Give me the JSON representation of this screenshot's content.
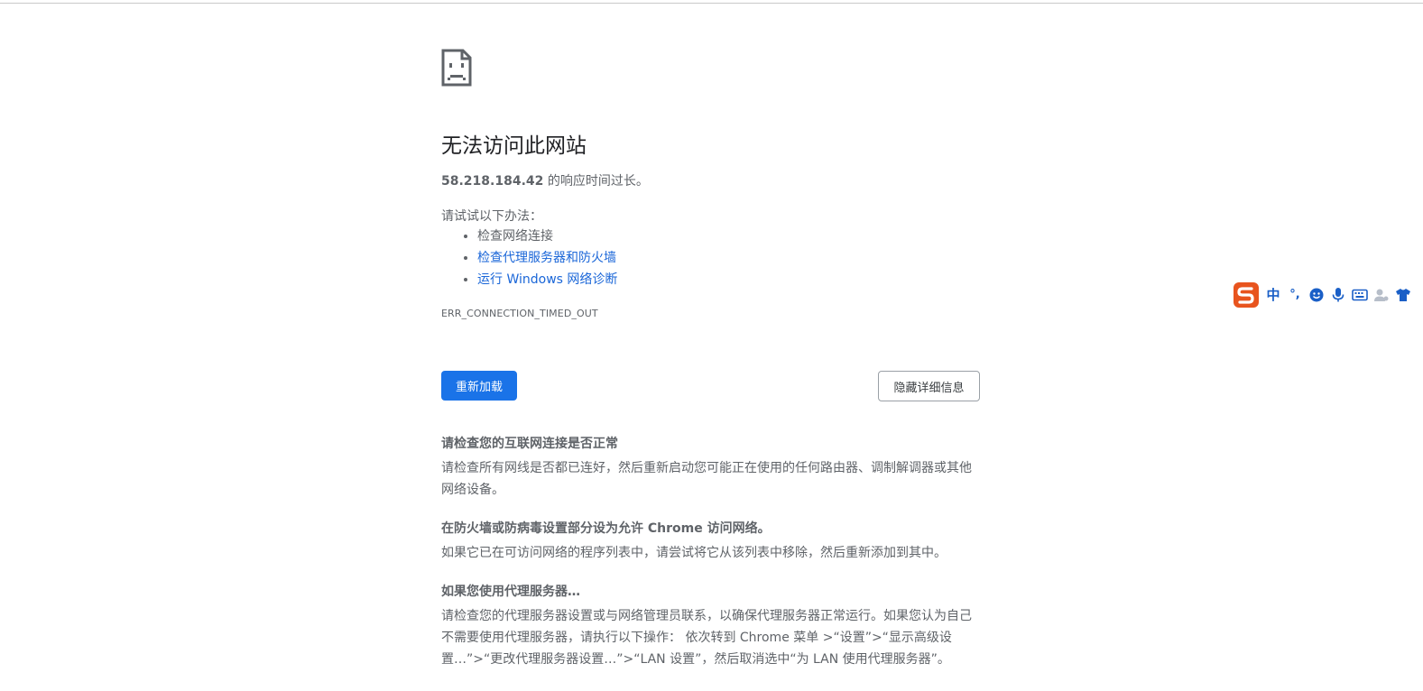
{
  "page": {
    "title": "无法访问此网站",
    "summary_host": "58.218.184.42",
    "summary_text": " 的响应时间过长。",
    "suggest_intro": "请试试以下办法：",
    "suggestions": [
      {
        "label": "检查网络连接",
        "is_link": false
      },
      {
        "label": "检查代理服务器和防火墙",
        "is_link": true
      },
      {
        "label": "运行 Windows 网络诊断",
        "is_link": true
      }
    ],
    "error_code": "ERR_CONNECTION_TIMED_OUT",
    "buttons": {
      "reload": "重新加载",
      "hide_details": "隐藏详细信息"
    }
  },
  "details": [
    {
      "heading": "请检查您的互联网连接是否正常",
      "body": "请检查所有网线是否都已连好，然后重新启动您可能正在使用的任何路由器、调制解调器或其他网络设备。"
    },
    {
      "heading": "在防火墙或防病毒设置部分设为允许 Chrome 访问网络。",
      "body": "如果它已在可访问网络的程序列表中，请尝试将它从该列表中移除，然后重新添加到其中。"
    },
    {
      "heading": "如果您使用代理服务器…",
      "body": "请检查您的代理服务器设置或与网络管理员联系，以确保代理服务器正常运行。如果您认为自己不需要使用代理服务器，请执行以下操作： 依次转到 Chrome 菜单 >“设置”>“显示高级设置…”>“更改代理服务器设置…”>“LAN 设置”，然后取消选中“为 LAN 使用代理服务器”。"
    }
  ],
  "ime": {
    "mode_label": "中",
    "punct_label": "°,",
    "icons": [
      "sogou-logo-icon",
      "emoji-icon",
      "microphone-icon",
      "keyboard-icon",
      "user-icon",
      "skin-shirt-icon"
    ],
    "brand_color": "#e8541e",
    "accent_color": "#1a5fc7"
  },
  "colors": {
    "link": "#1a66d8",
    "primary_button": "#1a73e8",
    "text": "#5f6368",
    "title": "#202124"
  }
}
